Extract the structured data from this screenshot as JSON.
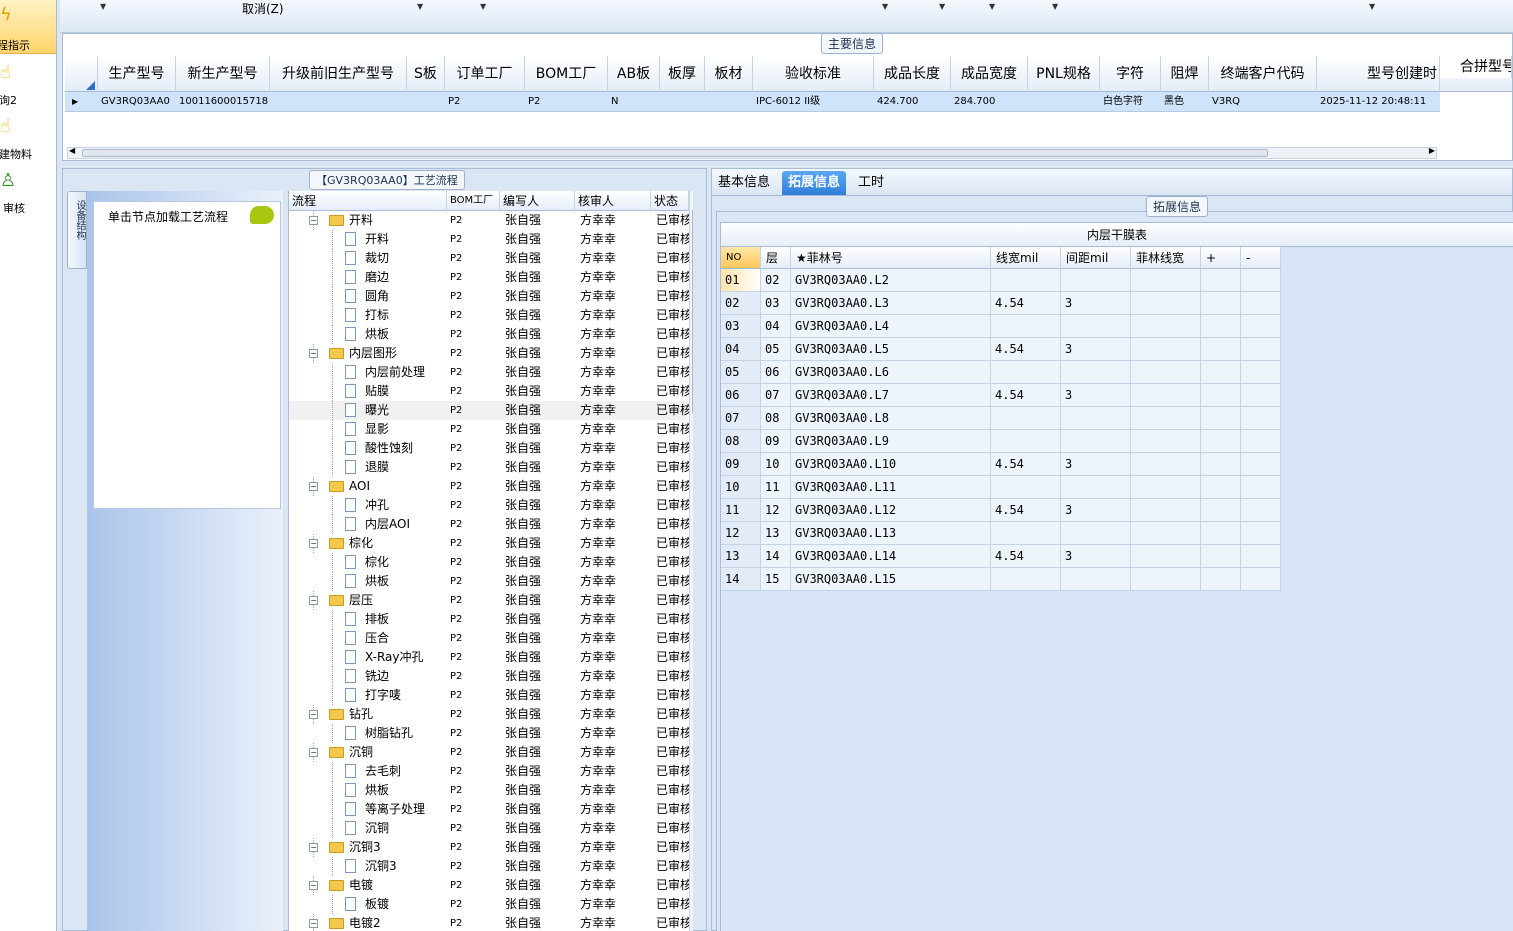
{
  "sidebar": {
    "items": [
      {
        "label": "程指示",
        "icon": "lightning-icon",
        "active": true
      },
      {
        "label": "询2",
        "icon": "hand-pointer-icon",
        "active": false
      },
      {
        "label": "建物料",
        "icon": "hand-pointer-icon",
        "active": false
      },
      {
        "label": "审核",
        "icon": "user-check-icon",
        "active": false
      }
    ]
  },
  "toolbar": {
    "cancel_label": "取消(Z)"
  },
  "main_section": {
    "tab_label": "主要信息",
    "columns": [
      "生产型号",
      "新生产型号",
      "升级前旧生产型号",
      "S板",
      "订单工厂",
      "BOM工厂",
      "AB板",
      "板厚",
      "板材",
      "验收标准",
      "成品长度",
      "成品宽度",
      "PNL规格",
      "字符",
      "阻焊",
      "终端客户代码",
      "型号创建时",
      "合拼型号"
    ],
    "row": [
      "GV3RQ03AA0",
      "10011600015718",
      "",
      "",
      "P2",
      "P2",
      "N",
      "",
      "",
      "IPC-6012 II级",
      "424.700",
      "284.700",
      "",
      "白色字符",
      "黑色",
      "V3RQ",
      "2025-11-12 20:48:11"
    ]
  },
  "process_panel": {
    "title": "【GV3RQ03AA0】工艺流程",
    "vertical_tab": "设备结构",
    "hint": "单击节点加载工艺流程",
    "columns": [
      "流程",
      "BOM工厂",
      "编写人",
      "核审人",
      "状态"
    ],
    "rows": [
      {
        "name": "开料",
        "type": "folder",
        "bom": "P2",
        "writer": "张自强",
        "reviewer": "方幸幸",
        "status": "已审核"
      },
      {
        "name": "开料",
        "type": "doc",
        "bom": "P2",
        "writer": "张自强",
        "reviewer": "方幸幸",
        "status": "已审核"
      },
      {
        "name": "裁切",
        "type": "doc",
        "bom": "P2",
        "writer": "张自强",
        "reviewer": "方幸幸",
        "status": "已审核"
      },
      {
        "name": "磨边",
        "type": "doc",
        "bom": "P2",
        "writer": "张自强",
        "reviewer": "方幸幸",
        "status": "已审核"
      },
      {
        "name": "圆角",
        "type": "doc",
        "bom": "P2",
        "writer": "张自强",
        "reviewer": "方幸幸",
        "status": "已审核"
      },
      {
        "name": "打标",
        "type": "doc",
        "bom": "P2",
        "writer": "张自强",
        "reviewer": "方幸幸",
        "status": "已审核"
      },
      {
        "name": "烘板",
        "type": "doc",
        "bom": "P2",
        "writer": "张自强",
        "reviewer": "方幸幸",
        "status": "已审核"
      },
      {
        "name": "内层图形",
        "type": "folder",
        "bom": "P2",
        "writer": "张自强",
        "reviewer": "方幸幸",
        "status": "已审核"
      },
      {
        "name": "内层前处理",
        "type": "doc",
        "bom": "P2",
        "writer": "张自强",
        "reviewer": "方幸幸",
        "status": "已审核"
      },
      {
        "name": "贴膜",
        "type": "doc",
        "bom": "P2",
        "writer": "张自强",
        "reviewer": "方幸幸",
        "status": "已审核"
      },
      {
        "name": "曝光",
        "type": "doc",
        "bom": "P2",
        "writer": "张自强",
        "reviewer": "方幸幸",
        "status": "已审核",
        "selected": true
      },
      {
        "name": "显影",
        "type": "doc",
        "bom": "P2",
        "writer": "张自强",
        "reviewer": "方幸幸",
        "status": "已审核"
      },
      {
        "name": "酸性蚀刻",
        "type": "doc",
        "bom": "P2",
        "writer": "张自强",
        "reviewer": "方幸幸",
        "status": "已审核"
      },
      {
        "name": "退膜",
        "type": "doc",
        "bom": "P2",
        "writer": "张自强",
        "reviewer": "方幸幸",
        "status": "已审核"
      },
      {
        "name": "AOI",
        "type": "folder",
        "bom": "P2",
        "writer": "张自强",
        "reviewer": "方幸幸",
        "status": "已审核"
      },
      {
        "name": "冲孔",
        "type": "doc",
        "bom": "P2",
        "writer": "张自强",
        "reviewer": "方幸幸",
        "status": "已审核"
      },
      {
        "name": "内层AOI",
        "type": "doc",
        "bom": "P2",
        "writer": "张自强",
        "reviewer": "方幸幸",
        "status": "已审核"
      },
      {
        "name": "棕化",
        "type": "folder",
        "bom": "P2",
        "writer": "张自强",
        "reviewer": "方幸幸",
        "status": "已审核"
      },
      {
        "name": "棕化",
        "type": "doc",
        "bom": "P2",
        "writer": "张自强",
        "reviewer": "方幸幸",
        "status": "已审核"
      },
      {
        "name": "烘板",
        "type": "doc",
        "bom": "P2",
        "writer": "张自强",
        "reviewer": "方幸幸",
        "status": "已审核"
      },
      {
        "name": "层压",
        "type": "folder",
        "bom": "P2",
        "writer": "张自强",
        "reviewer": "方幸幸",
        "status": "已审核"
      },
      {
        "name": "排板",
        "type": "doc",
        "bom": "P2",
        "writer": "张自强",
        "reviewer": "方幸幸",
        "status": "已审核"
      },
      {
        "name": "压合",
        "type": "doc",
        "bom": "P2",
        "writer": "张自强",
        "reviewer": "方幸幸",
        "status": "已审核"
      },
      {
        "name": "X-Ray冲孔",
        "type": "doc",
        "bom": "P2",
        "writer": "张自强",
        "reviewer": "方幸幸",
        "status": "已审核"
      },
      {
        "name": "铣边",
        "type": "doc",
        "bom": "P2",
        "writer": "张自强",
        "reviewer": "方幸幸",
        "status": "已审核"
      },
      {
        "name": "打字唛",
        "type": "doc",
        "bom": "P2",
        "writer": "张自强",
        "reviewer": "方幸幸",
        "status": "已审核"
      },
      {
        "name": "钻孔",
        "type": "folder",
        "bom": "P2",
        "writer": "张自强",
        "reviewer": "方幸幸",
        "status": "已审核"
      },
      {
        "name": "树脂钻孔",
        "type": "doc",
        "bom": "P2",
        "writer": "张自强",
        "reviewer": "方幸幸",
        "status": "已审核"
      },
      {
        "name": "沉铜",
        "type": "folder",
        "bom": "P2",
        "writer": "张自强",
        "reviewer": "方幸幸",
        "status": "已审核"
      },
      {
        "name": "去毛刺",
        "type": "doc",
        "bom": "P2",
        "writer": "张自强",
        "reviewer": "方幸幸",
        "status": "已审核"
      },
      {
        "name": "烘板",
        "type": "doc",
        "bom": "P2",
        "writer": "张自强",
        "reviewer": "方幸幸",
        "status": "已审核"
      },
      {
        "name": "等离子处理",
        "type": "doc",
        "bom": "P2",
        "writer": "张自强",
        "reviewer": "方幸幸",
        "status": "已审核"
      },
      {
        "name": "沉铜",
        "type": "doc",
        "bom": "P2",
        "writer": "张自强",
        "reviewer": "方幸幸",
        "status": "已审核"
      },
      {
        "name": "沉铜3",
        "type": "folder",
        "bom": "P2",
        "writer": "张自强",
        "reviewer": "方幸幸",
        "status": "已审核"
      },
      {
        "name": "沉铜3",
        "type": "doc",
        "bom": "P2",
        "writer": "张自强",
        "reviewer": "方幸幸",
        "status": "已审核"
      },
      {
        "name": "电镀",
        "type": "folder",
        "bom": "P2",
        "writer": "张自强",
        "reviewer": "方幸幸",
        "status": "已审核"
      },
      {
        "name": "板镀",
        "type": "doc",
        "bom": "P2",
        "writer": "张自强",
        "reviewer": "方幸幸",
        "status": "已审核"
      },
      {
        "name": "电镀2",
        "type": "folder",
        "bom": "P2",
        "writer": "张自强",
        "reviewer": "方幸幸",
        "status": "已审核"
      }
    ]
  },
  "right_panel": {
    "tabs": [
      {
        "label": "基本信息",
        "active": false
      },
      {
        "label": "拓展信息",
        "active": true
      },
      {
        "label": "工时",
        "active": false
      }
    ],
    "section_label": "拓展信息",
    "table_title": "内层干膜表",
    "columns": [
      "NO",
      "层",
      "★菲林号",
      "线宽mil",
      "间距mil",
      "菲林线宽",
      "+",
      "-"
    ],
    "rows": [
      [
        "01",
        "02",
        "GV3RQ03AA0.L2",
        "",
        "",
        ""
      ],
      [
        "02",
        "03",
        "GV3RQ03AA0.L3",
        "4.54",
        "3",
        ""
      ],
      [
        "03",
        "04",
        "GV3RQ03AA0.L4",
        "",
        "",
        ""
      ],
      [
        "04",
        "05",
        "GV3RQ03AA0.L5",
        "4.54",
        "3",
        ""
      ],
      [
        "05",
        "06",
        "GV3RQ03AA0.L6",
        "",
        "",
        ""
      ],
      [
        "06",
        "07",
        "GV3RQ03AA0.L7",
        "4.54",
        "3",
        ""
      ],
      [
        "07",
        "08",
        "GV3RQ03AA0.L8",
        "",
        "",
        ""
      ],
      [
        "08",
        "09",
        "GV3RQ03AA0.L9",
        "",
        "",
        ""
      ],
      [
        "09",
        "10",
        "GV3RQ03AA0.L10",
        "4.54",
        "3",
        ""
      ],
      [
        "10",
        "11",
        "GV3RQ03AA0.L11",
        "",
        "",
        ""
      ],
      [
        "11",
        "12",
        "GV3RQ03AA0.L12",
        "4.54",
        "3",
        ""
      ],
      [
        "12",
        "13",
        "GV3RQ03AA0.L13",
        "",
        "",
        ""
      ],
      [
        "13",
        "14",
        "GV3RQ03AA0.L14",
        "4.54",
        "3",
        ""
      ],
      [
        "14",
        "15",
        "GV3RQ03AA0.L15",
        "",
        "",
        ""
      ]
    ]
  }
}
